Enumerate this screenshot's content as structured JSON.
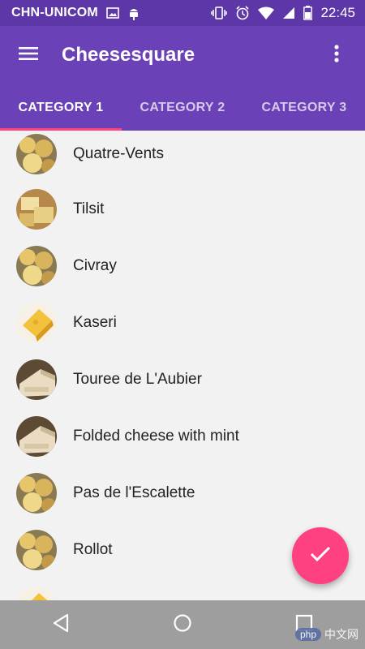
{
  "status_bar": {
    "carrier": "CHN-UNICOM",
    "time": "22:45",
    "icons": [
      "image-icon",
      "android-icon",
      "vibrate-icon",
      "alarm-icon",
      "wifi-icon",
      "signal-icon",
      "battery-icon"
    ]
  },
  "app_bar": {
    "title": "Cheesesquare",
    "menu_icon": "hamburger-menu-icon",
    "overflow_icon": "more-vert-icon"
  },
  "tabs": [
    {
      "label": "CATEGORY 1",
      "selected": true
    },
    {
      "label": "CATEGORY 2",
      "selected": false
    },
    {
      "label": "CATEGORY 3",
      "selected": false
    }
  ],
  "list": {
    "items": [
      {
        "label": "Quatre-Vents"
      },
      {
        "label": "Tilsit"
      },
      {
        "label": "Civray"
      },
      {
        "label": "Kaseri"
      },
      {
        "label": "Touree de L'Aubier"
      },
      {
        "label": "Folded cheese with mint"
      },
      {
        "label": "Pas de l'Escalette"
      },
      {
        "label": "Rollot"
      }
    ]
  },
  "fab": {
    "icon": "check-icon"
  },
  "nav_bar": {
    "icons": [
      "back-icon",
      "home-icon",
      "recents-icon"
    ]
  },
  "watermark": {
    "badge": "php",
    "text": "中文网"
  },
  "colors": {
    "status_bar": "#5d37a7",
    "primary": "#6a41b7",
    "accent": "#ff4081",
    "background": "#f2f2f2",
    "nav_bar": "#9e9e9e"
  }
}
